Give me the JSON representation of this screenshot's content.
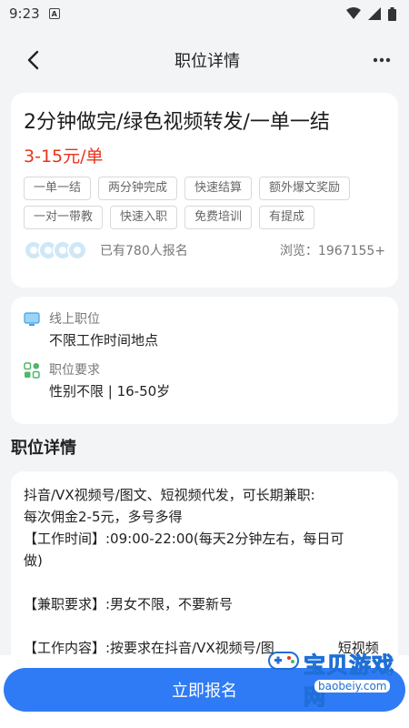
{
  "status_bar": {
    "time": "9:23"
  },
  "nav": {
    "title": "职位详情"
  },
  "job": {
    "title": "2分钟做完/绿色视频转发/一单一结",
    "salary": "3-15元/单",
    "tags": [
      "一单一结",
      "两分钟完成",
      "快速结算",
      "额外爆文奖励",
      "一对一带教",
      "快速入职",
      "免费培训",
      "有提成"
    ],
    "enrolled": "已有780人报名",
    "views": "浏览：1967155+"
  },
  "info": {
    "location_label": "线上职位",
    "location_value": "不限工作时间地点",
    "requirement_label": "职位要求",
    "requirement_value": "性别不限 | 16-50岁"
  },
  "detail": {
    "section_title": "职位详情",
    "line1": "抖音/VX视频号/图文、短视频代发，可长期兼职:",
    "line2": "每次佣金2-5元，多号多得",
    "line3": "【工作时间】:09:00-22:00(每天2分钟左右，每日可",
    "line4": "做)",
    "line5": "【兼职要求】:男女不限，不要新号",
    "line6": "【工作内容】:按要求在抖音/VX视频号/图",
    "line6_tail": "短视频"
  },
  "bottom": {
    "apply_label": "立即报名"
  },
  "watermark": {
    "text": "宝贝游戏网",
    "url": "baobeiy.com"
  },
  "colors": {
    "accent": "#2f7bf6",
    "salary": "#e8341c"
  }
}
